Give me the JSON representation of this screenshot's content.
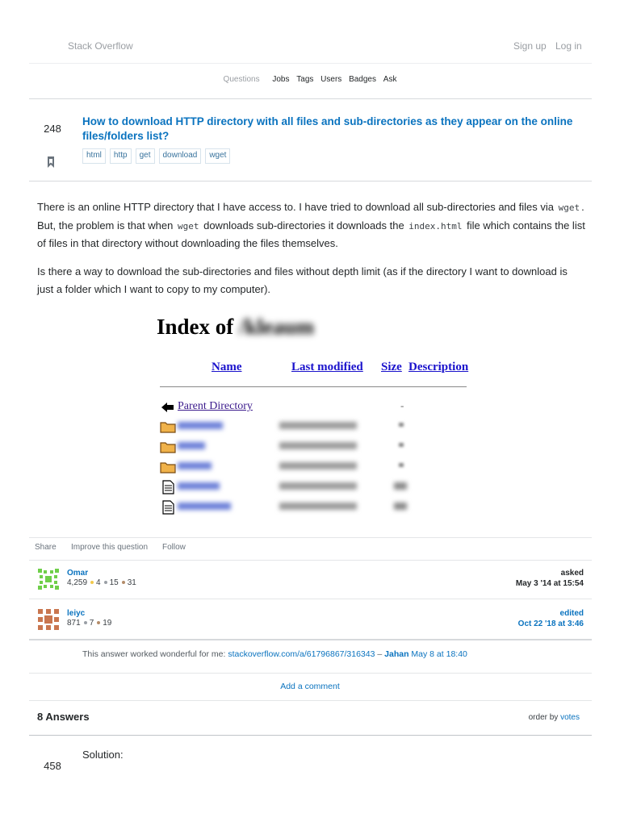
{
  "header": {
    "brand": "Stack Overflow",
    "signup": "Sign up",
    "login": "Log in",
    "nav": [
      "Questions",
      "Jobs",
      "Tags",
      "Users",
      "Badges",
      "Ask"
    ]
  },
  "question": {
    "votes": "248",
    "title": "How to download HTTP directory with all files and sub-directories as they appear on the online files/folders list?",
    "tags": [
      "html",
      "http",
      "get",
      "download",
      "wget"
    ],
    "p1": {
      "a": "There is an online HTTP directory that I have access to. I have tried to download all sub-directories and files via ",
      "code1": "wget",
      "b": ". But, the problem is that when ",
      "code2": "wget",
      "c": " downloads sub-directories it downloads the ",
      "code3": "index.html",
      "d": " file which contains the list of files in that directory without downloading the files themselves."
    },
    "p2": "Is there a way to download the sub-directories and files without depth limit (as if the directory I want to download is just a folder which I want to copy to my computer).",
    "image": {
      "title_prefix": "Index of",
      "title_blurred": "/kleaum",
      "columns": [
        "Name",
        "Last modified",
        "Size",
        "Description"
      ],
      "parent_link": "Parent Directory",
      "parent_size": "-"
    },
    "post_menu": {
      "share": "Share",
      "improve": "Improve this question",
      "follow": "Follow"
    },
    "asker": {
      "label": "asked",
      "date": "May 3 '14 at 15:54",
      "name": "Omar",
      "rep": "4,259",
      "gold": "4",
      "silver": "15",
      "bronze": "31"
    },
    "editor": {
      "label": "edited",
      "date": "Oct 22 '18 at 3:46",
      "name": "leiyc",
      "rep": "871",
      "silver": "7",
      "bronze": "19"
    },
    "comment": {
      "text": "This answer worked wonderful for me: ",
      "link": "stackoverflow.com/a/61796867/316343",
      "sep": " – ",
      "user": "Jahan",
      "date": "May 8 at 18:40"
    },
    "add_comment": "Add a comment"
  },
  "answers": {
    "title": "8 Answers",
    "order_prefix": "order by ",
    "order_value": "votes",
    "first": {
      "votes": "458",
      "text": "Solution:"
    }
  },
  "colors": {
    "link": "#0a73bf",
    "tag_text": "#39739d",
    "gold_badge": "#f2c94c",
    "silver_badge": "#9a9fa6",
    "bronze_badge": "#b48c6a"
  }
}
